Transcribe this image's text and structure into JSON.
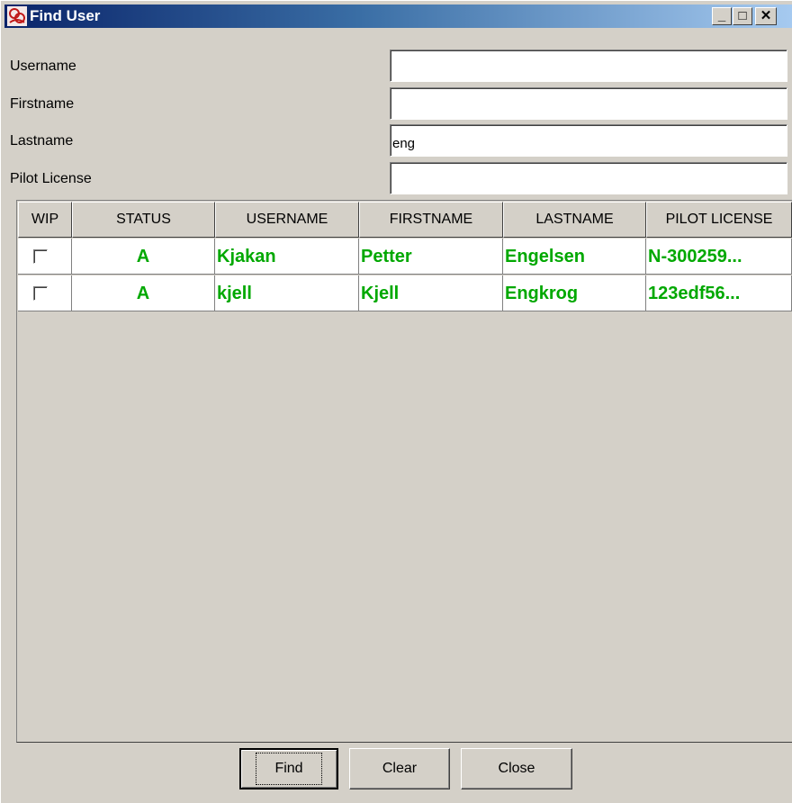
{
  "window": {
    "title": "Find User",
    "min_glyph": "_",
    "max_glyph": "□",
    "close_glyph": "✕"
  },
  "form": {
    "username_label": "Username",
    "username_value": "",
    "firstname_label": "Firstname",
    "firstname_value": "",
    "lastname_label": "Lastname",
    "lastname_value": "eng",
    "pilot_license_label": "Pilot License",
    "pilot_license_value": ""
  },
  "table": {
    "columns": [
      "WIP",
      "STATUS",
      "USERNAME",
      "FIRSTNAME",
      "LASTNAME",
      "PILOT LICENSE"
    ],
    "rows": [
      {
        "wip": false,
        "status": "A",
        "username": "Kjakan",
        "firstname": "Petter",
        "lastname": "Engelsen",
        "pilot_license": "N-300259..."
      },
      {
        "wip": false,
        "status": "A",
        "username": "kjell",
        "firstname": "Kjell",
        "lastname": "Engkrog",
        "pilot_license": "123edf56..."
      }
    ],
    "text_color": "#00a800"
  },
  "buttons": {
    "find": "Find",
    "clear": "Clear",
    "close": "Close"
  },
  "colors": {
    "background": "#d4d0c8",
    "titlebar_start": "#0a246a",
    "titlebar_end": "#a6caf0"
  }
}
